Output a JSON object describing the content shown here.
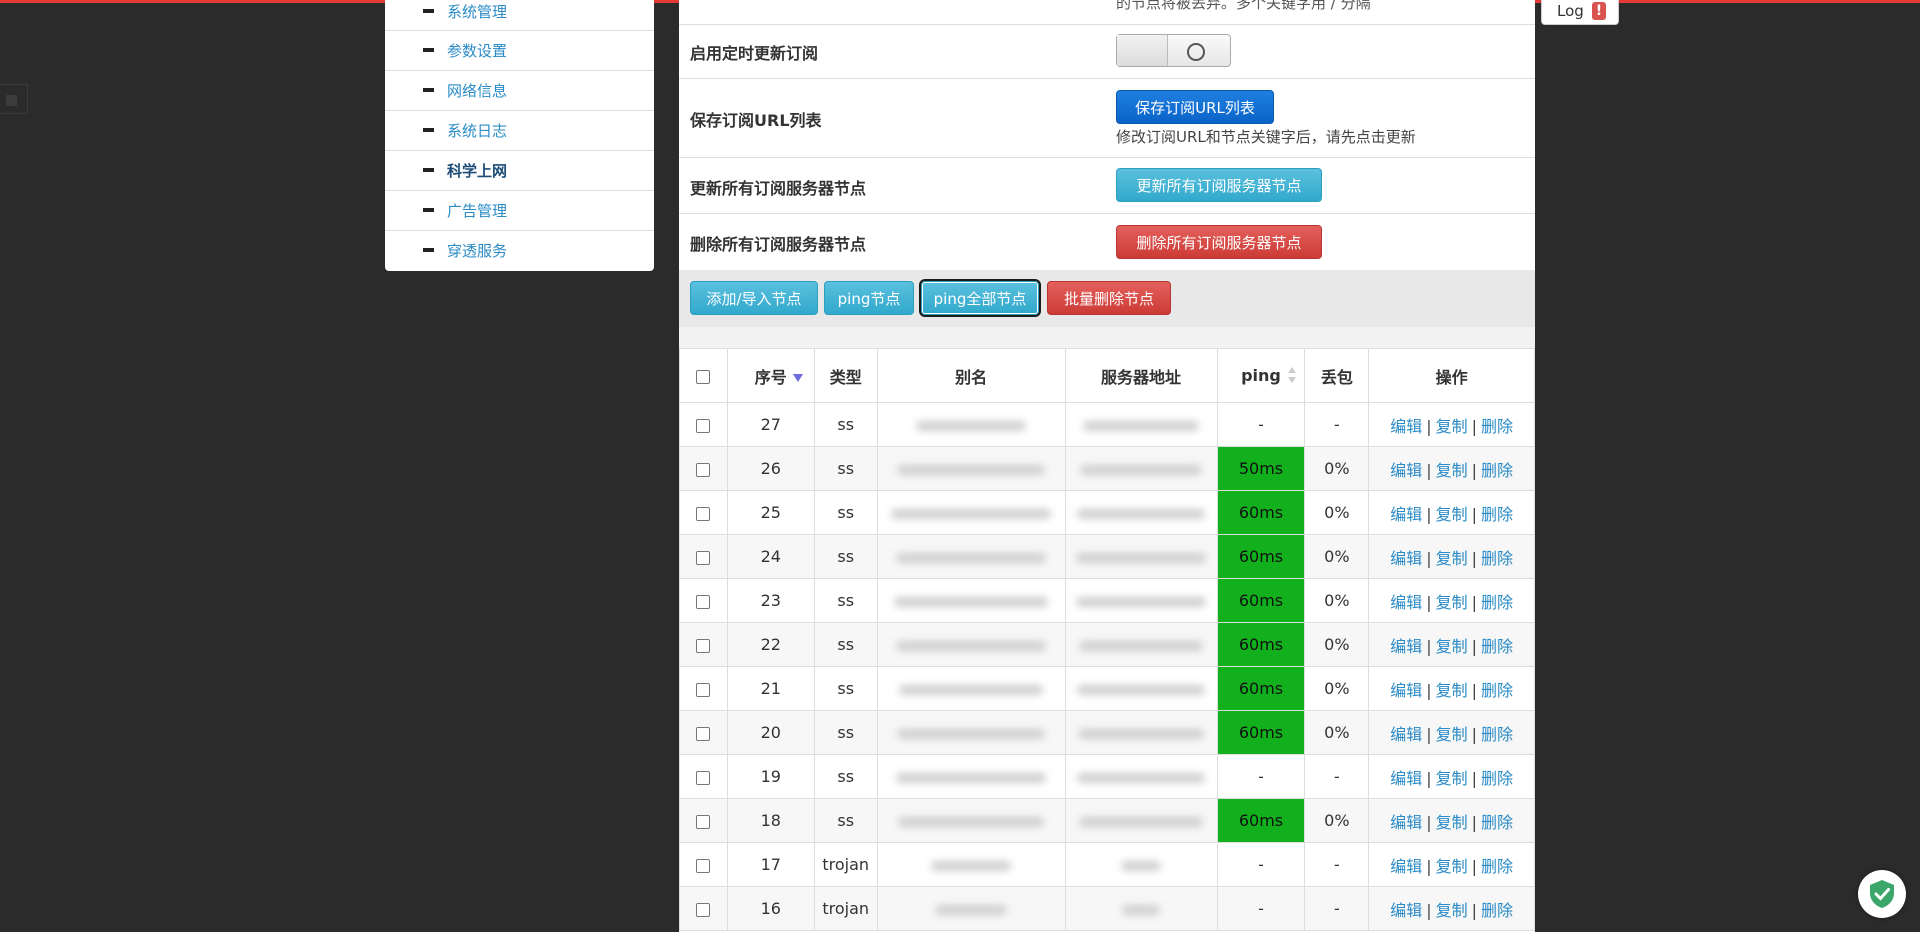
{
  "sidebar": {
    "items": [
      {
        "label": "系统管理",
        "active": false
      },
      {
        "label": "参数设置",
        "active": false
      },
      {
        "label": "网络信息",
        "active": false
      },
      {
        "label": "系统日志",
        "active": false
      },
      {
        "label": "科学上网",
        "active": true
      },
      {
        "label": "广告管理",
        "active": false
      },
      {
        "label": "穿透服务",
        "active": false
      }
    ]
  },
  "log_button": {
    "label": "Log",
    "badge": "!"
  },
  "settings": {
    "top_hint": "的节点将被丢弃。多个关键字用 / 分隔",
    "auto_update": {
      "label": "启用定时更新订阅",
      "state": "off"
    },
    "save_urls": {
      "label": "保存订阅URL列表",
      "button": "保存订阅URL列表",
      "hint": "修改订阅URL和节点关键字后，请先点击更新"
    },
    "update_all": {
      "label": "更新所有订阅服务器节点",
      "button": "更新所有订阅服务器节点"
    },
    "delete_all": {
      "label": "删除所有订阅服务器节点",
      "button": "删除所有订阅服务器节点"
    }
  },
  "toolbar": {
    "add_import": "添加/导入节点",
    "ping_node": "ping节点",
    "ping_all": "ping全部节点",
    "batch_delete": "批量删除节点"
  },
  "table": {
    "headers": {
      "index": "序号",
      "type": "类型",
      "alias": "别名",
      "server": "服务器地址",
      "ping": "ping",
      "loss": "丢包",
      "ops": "操作"
    },
    "ops": {
      "edit": "编辑",
      "copy": "复制",
      "delete": "删除",
      "sep": "|"
    },
    "rows": [
      {
        "index": "27",
        "type": "ss",
        "ping": "-",
        "loss": "-",
        "ok": false
      },
      {
        "index": "26",
        "type": "ss",
        "ping": "50ms",
        "loss": "0%",
        "ok": true
      },
      {
        "index": "25",
        "type": "ss",
        "ping": "60ms",
        "loss": "0%",
        "ok": true
      },
      {
        "index": "24",
        "type": "ss",
        "ping": "60ms",
        "loss": "0%",
        "ok": true
      },
      {
        "index": "23",
        "type": "ss",
        "ping": "60ms",
        "loss": "0%",
        "ok": true
      },
      {
        "index": "22",
        "type": "ss",
        "ping": "60ms",
        "loss": "0%",
        "ok": true
      },
      {
        "index": "21",
        "type": "ss",
        "ping": "60ms",
        "loss": "0%",
        "ok": true
      },
      {
        "index": "20",
        "type": "ss",
        "ping": "60ms",
        "loss": "0%",
        "ok": true
      },
      {
        "index": "19",
        "type": "ss",
        "ping": "-",
        "loss": "-",
        "ok": false
      },
      {
        "index": "18",
        "type": "ss",
        "ping": "60ms",
        "loss": "0%",
        "ok": true
      },
      {
        "index": "17",
        "type": "trojan",
        "ping": "-",
        "loss": "-",
        "ok": false
      },
      {
        "index": "16",
        "type": "trojan",
        "ping": "-",
        "loss": "-",
        "ok": false
      }
    ]
  },
  "colors": {
    "ping_ok": "#11b01c",
    "link": "#2a8bc6",
    "topline": "#e53935"
  },
  "icons": {
    "security_widget": "shield-check-icon"
  }
}
